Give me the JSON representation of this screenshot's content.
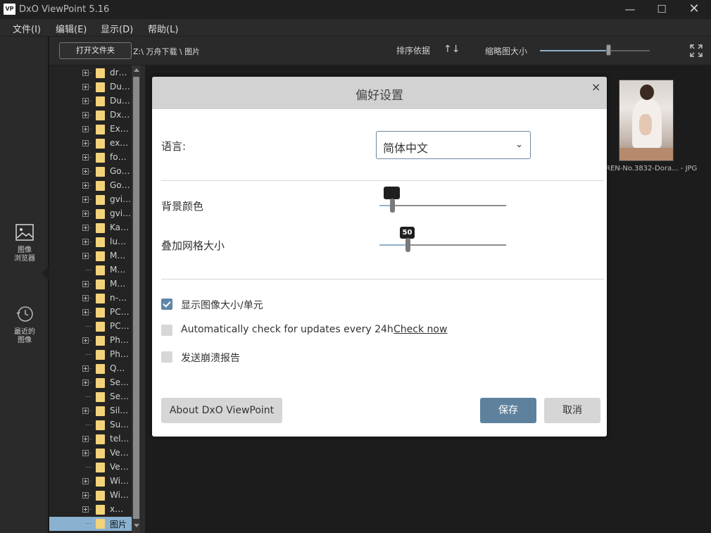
{
  "window": {
    "logo": "VP",
    "title": "DxO ViewPoint 5.16",
    "minimize_glyph": "—",
    "maximize_glyph": "☐",
    "close_glyph": "✕"
  },
  "menu": [
    "文件(I)",
    "编辑(E)",
    "显示(D)",
    "帮助(L)"
  ],
  "nav": [
    {
      "label": "图像\n浏览器",
      "icon": "image-browser-icon",
      "active": true
    },
    {
      "label": "最近的\n图像",
      "icon": "recent-images-icon",
      "active": false
    }
  ],
  "toolbar": {
    "open_folder": "打开文件夹",
    "path": "Z:\\ 万舟下载 \\ 图片",
    "sort_label": "排序依据",
    "sort_icon": "sort-icon",
    "sort_glyph": "↑↓",
    "thumb_size_label": "缩略图大小",
    "thumb_size_level": 0.62
  },
  "tree": {
    "items": [
      {
        "name": "dr…",
        "expand": true
      },
      {
        "name": "Du…",
        "expand": true
      },
      {
        "name": "Du…",
        "expand": true
      },
      {
        "name": "Dx…",
        "expand": true
      },
      {
        "name": "Ex…",
        "expand": true
      },
      {
        "name": "ex…",
        "expand": true
      },
      {
        "name": "fo…",
        "expand": true
      },
      {
        "name": "Go…",
        "expand": true
      },
      {
        "name": "Go…",
        "expand": true
      },
      {
        "name": "gvi…",
        "expand": true
      },
      {
        "name": "gvi…",
        "expand": true
      },
      {
        "name": "Ka…",
        "expand": true
      },
      {
        "name": "lu…",
        "expand": true
      },
      {
        "name": "M…",
        "expand": true
      },
      {
        "name": "M…",
        "expand": false
      },
      {
        "name": "M…",
        "expand": true
      },
      {
        "name": "n-…",
        "expand": true
      },
      {
        "name": "PC…",
        "expand": true
      },
      {
        "name": "PC…",
        "expand": false
      },
      {
        "name": "Ph…",
        "expand": true
      },
      {
        "name": "Ph…",
        "expand": false
      },
      {
        "name": "Q…",
        "expand": true
      },
      {
        "name": "Se…",
        "expand": true
      },
      {
        "name": "Se…",
        "expand": false
      },
      {
        "name": "Sil…",
        "expand": true
      },
      {
        "name": "Su…",
        "expand": false
      },
      {
        "name": "tel…",
        "expand": true
      },
      {
        "name": "Ve…",
        "expand": true
      },
      {
        "name": "Ve…",
        "expand": false
      },
      {
        "name": "Wi…",
        "expand": true
      },
      {
        "name": "Wi…",
        "expand": true
      },
      {
        "name": "x…",
        "expand": true
      },
      {
        "name": "图片",
        "expand": false,
        "selected": true
      }
    ]
  },
  "thumbnail": {
    "caption": "REN-No.3832-Dora... - JPG"
  },
  "dialog": {
    "title": "偏好设置",
    "close_glyph": "×",
    "language_label": "语言:",
    "language_value": "简体中文",
    "language_chevron": "⌄",
    "bg_color_label": "背景颜色",
    "bg_color_level": 0.1,
    "bg_swatch_color": "#1e1e1e",
    "grid_size_label": "叠加网格大小",
    "grid_size_value": "50",
    "grid_size_level": 0.22,
    "options": [
      {
        "label": "显示图像大小/单元",
        "checked": true
      },
      {
        "label": "Automatically check for updates every 24h",
        "checked": false
      },
      {
        "label": "发送崩溃报告",
        "checked": false
      }
    ],
    "check_now": "Check now",
    "about_button": "About DxO ViewPoint",
    "save_button": "保存",
    "cancel_button": "取消"
  },
  "colors": {
    "accent": "#5e819e",
    "selection": "#8ab1cf",
    "folder": "#f2d27a",
    "slider_fill": "#8fb2cd"
  }
}
